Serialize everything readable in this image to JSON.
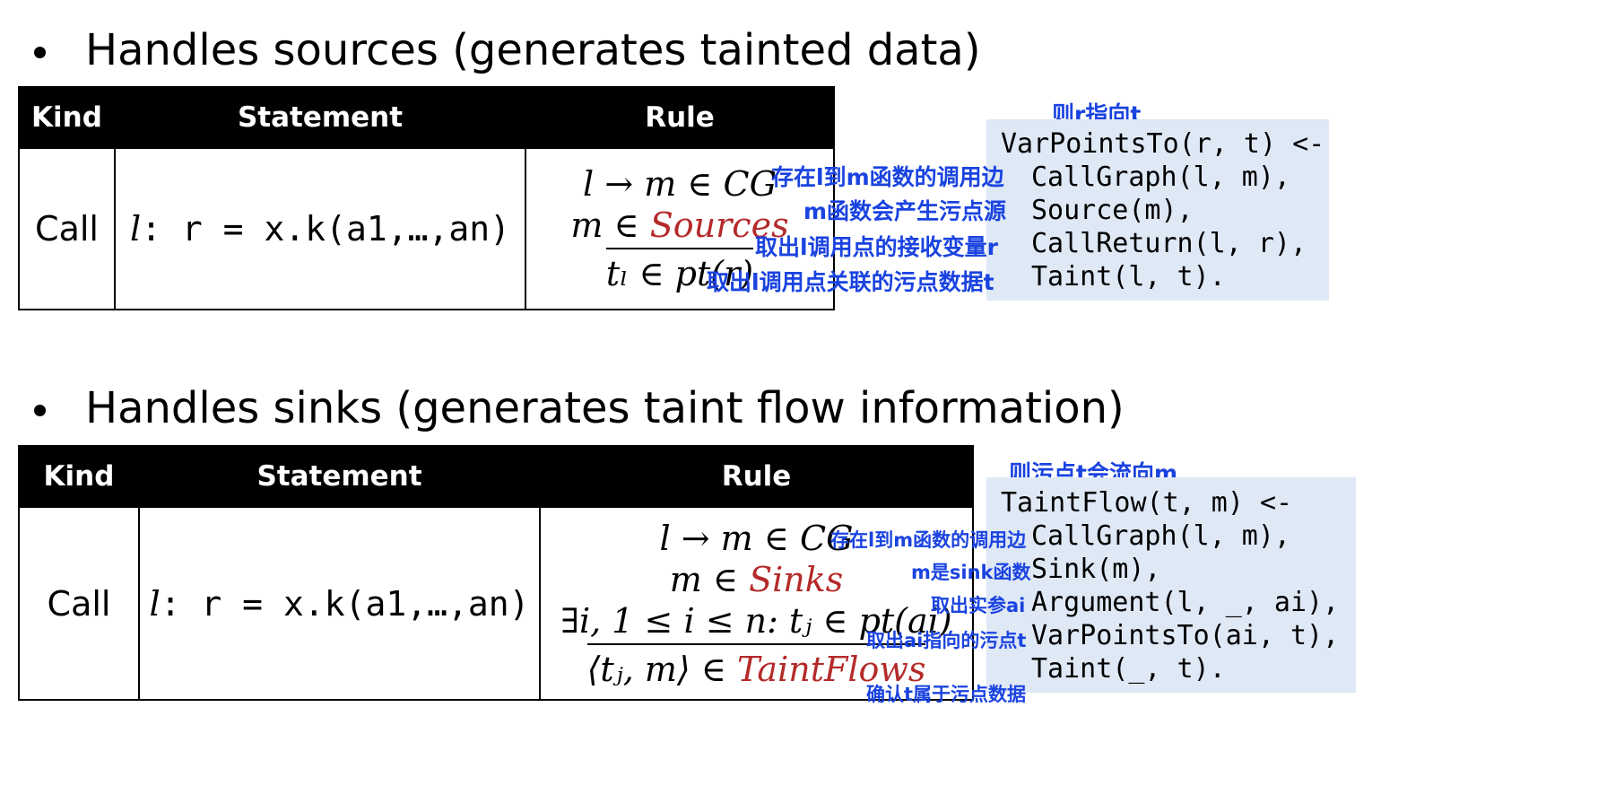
{
  "section1": {
    "bullet": "Handles sources (generates tainted data)",
    "table": {
      "headers": [
        "Kind",
        "Statement",
        "Rule"
      ],
      "kind": "Call",
      "stmt_label": "l",
      "stmt_code": ": r = x.k(a1,…,an)",
      "rule_line1": "l → m ∈ CG",
      "rule_line2_prefix": "m ∈ ",
      "rule_line2_red": "Sources",
      "rule_line3": "tₗ ∈ pt(r)"
    },
    "code_title_note": "则r指向t",
    "code_lines": [
      "VarPointsTo(r, t) <-",
      "CallGraph(l, m),",
      "Source(m),",
      "CallReturn(l, r),",
      "Taint(l, t)."
    ],
    "notes": [
      "存在l到m函数的调用边",
      "m函数会产生污点源",
      "取出l调用点的接收变量r",
      "取出l调用点关联的污点数据t"
    ]
  },
  "section2": {
    "bullet": "Handles sinks (generates taint flow information)",
    "table": {
      "headers": [
        "Kind",
        "Statement",
        "Rule"
      ],
      "kind": "Call",
      "stmt_label": "l",
      "stmt_code": ": r = x.k(a1,…,an)",
      "rule_line1": "l → m ∈ CG",
      "rule_line2_prefix": "m ∈ ",
      "rule_line2_red": "Sinks",
      "rule_line3": "∃i, 1 ≤ i ≤ n: tⱼ ∈ pt(ai)",
      "rule_line4_prefix": "⟨tⱼ, m⟩ ∈ ",
      "rule_line4_red": "TaintFlows"
    },
    "code_title_note": "则污点t会流向m",
    "code_lines": [
      "TaintFlow(t, m) <-",
      "CallGraph(l, m),",
      "Sink(m),",
      "Argument(l, _, ai),",
      "VarPointsTo(ai, t),",
      "Taint(_, t)."
    ],
    "notes": [
      "存在l到m函数的调用边",
      "m是sink函数",
      "取出实参ai",
      "取出ai指向的污点t",
      "确认t属于污点数据"
    ]
  },
  "colors": {
    "note_blue": "#1a43e0",
    "code_bg": "#dfe8f5",
    "rule_red": "#b52a2a",
    "header_bg": "#000000"
  }
}
